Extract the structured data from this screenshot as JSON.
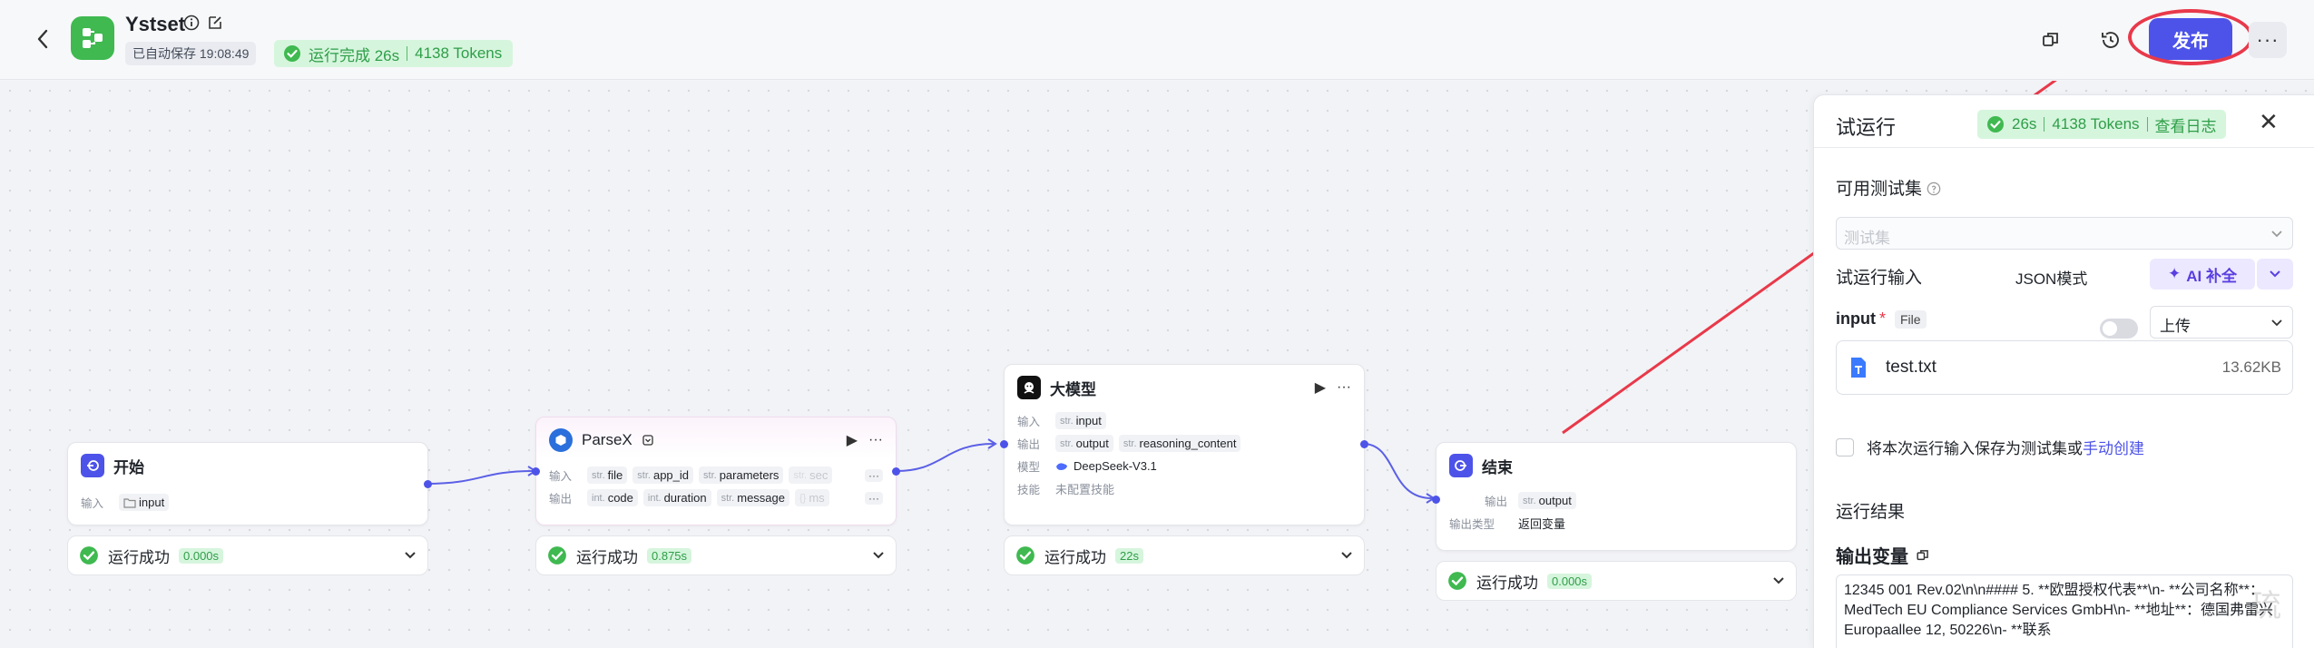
{
  "header": {
    "app_name": "Ystset",
    "autosave": "已自动保存 19:08:49",
    "run_status": "运行完成 26s",
    "run_tokens": "4138 Tokens",
    "publish_label": "发布",
    "more_label": "···"
  },
  "nodes": {
    "start": {
      "title": "开始",
      "input_label": "输入",
      "input_value": "input",
      "status": "运行成功",
      "duration": "0.000s"
    },
    "parsex": {
      "title": "ParseX",
      "input_label": "输入",
      "inputs": [
        {
          "type": "str.",
          "name": "file"
        },
        {
          "type": "str.",
          "name": "app_id"
        },
        {
          "type": "str.",
          "name": "parameters"
        },
        {
          "type": "str.",
          "name": "sec"
        }
      ],
      "output_label": "输出",
      "outputs": [
        {
          "type": "int.",
          "name": "code"
        },
        {
          "type": "int.",
          "name": "duration"
        },
        {
          "type": "str.",
          "name": "message"
        },
        {
          "type": "{}",
          "name": "ms"
        }
      ],
      "more": "···",
      "status": "运行成功",
      "duration": "0.875s"
    },
    "llm": {
      "title": "大模型",
      "input_label": "输入",
      "input": {
        "type": "str.",
        "name": "input"
      },
      "output_label": "输出",
      "outputs": [
        {
          "type": "str.",
          "name": "output"
        },
        {
          "type": "str.",
          "name": "reasoning_content"
        }
      ],
      "model_label": "模型",
      "model_value": "DeepSeek-V3.1",
      "skill_label": "技能",
      "skill_value": "未配置技能",
      "status": "运行成功",
      "duration": "22s"
    },
    "end": {
      "title": "结束",
      "output_label": "输出",
      "output": {
        "type": "str.",
        "name": "output"
      },
      "output_type_label": "输出类型",
      "output_type_value": "返回变量",
      "status": "运行成功",
      "duration": "0.000s"
    }
  },
  "panel": {
    "title": "试运行",
    "badge_time": "26s",
    "badge_tokens": "4138 Tokens",
    "badge_log": "查看日志",
    "close": "✕",
    "testset_label": "可用测试集",
    "testset_placeholder": "测试集",
    "trial_input_label": "试运行输入",
    "json_mode_label": "JSON模式",
    "ai_fill_label": "AI 补全",
    "input_name": "input",
    "input_required": "*",
    "input_type": "File",
    "upload_label": "上传",
    "file_name": "test.txt",
    "file_size": "13.62KB",
    "save_text": "将本次运行输入保存为测试集或",
    "save_link": "手动创建",
    "result_label": "运行结果",
    "output_var_label": "输出变量",
    "output_text": "12345 001 Rev.02\\n\\n#### 5. **欧盟授权代表**\\n- **公司名称**：MedTech EU Compliance Services GmbH\\n- **地址**：德国弗雷兴 Europaallee 12, 50226\\n- **联系"
  },
  "watermark": "琉",
  "colors": {
    "accent": "#4d53e8",
    "success": "#2e9e48",
    "success_bg": "#d6f5dd",
    "logo_green": "#3fb950",
    "annotation_red": "#e8394a"
  }
}
